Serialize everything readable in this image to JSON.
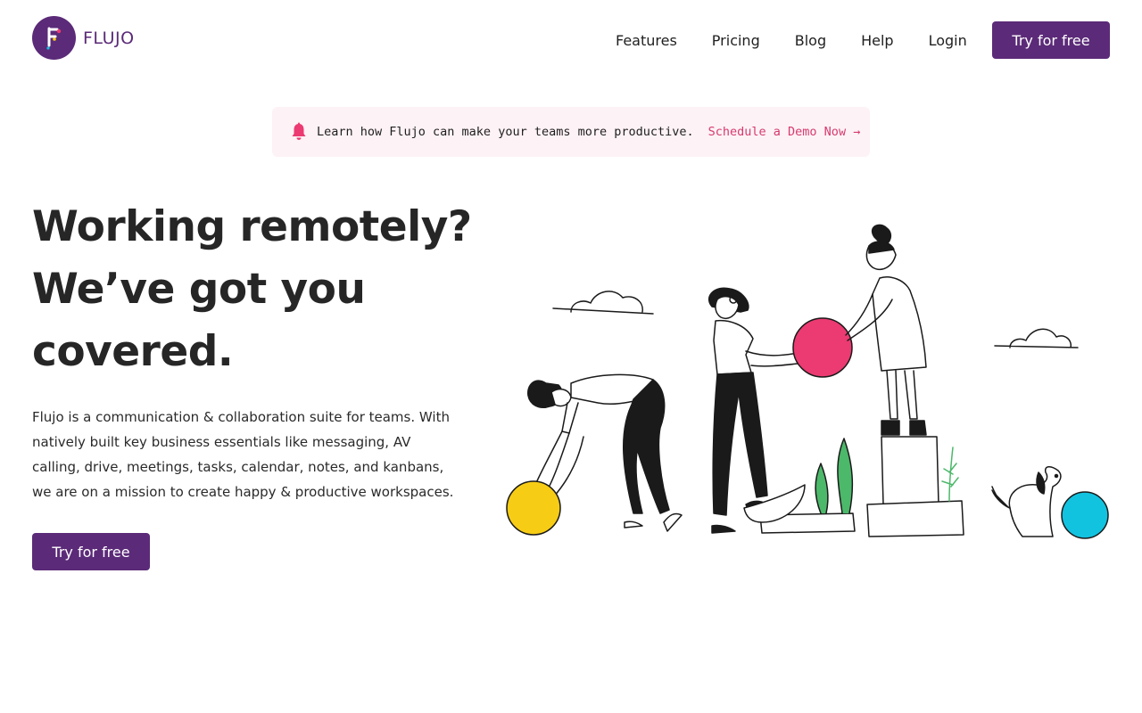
{
  "brand": {
    "name": "FLUJO",
    "color": "#5b2a78"
  },
  "nav": {
    "items": [
      {
        "label": "Features"
      },
      {
        "label": "Pricing"
      },
      {
        "label": "Blog"
      },
      {
        "label": "Help"
      },
      {
        "label": "Login"
      }
    ],
    "cta_label": "Try for free"
  },
  "banner": {
    "icon": "bell-icon",
    "text": "Learn how Flujo can make your teams more productive.",
    "link_label": "Schedule a Demo Now →",
    "link_color": "#d63a70",
    "background": "#fdf2f5"
  },
  "hero": {
    "title_lines": [
      "Working remotely?",
      "We’ve got you",
      "covered."
    ],
    "description": "Flujo is a communication & collaboration suite for teams. With natively built key business essentials like messaging, AV calling, drive, meetings, tasks, calendar, notes, and kanbans, we are on a mission to create happy & productive workspaces.",
    "cta_label": "Try for free"
  },
  "illustration": {
    "icon": "team-collaboration-illustration",
    "colors": {
      "yellow": "#f7cc15",
      "pink": "#ec3a72",
      "cyan": "#12c3e0",
      "green": "#4cb86a"
    }
  }
}
